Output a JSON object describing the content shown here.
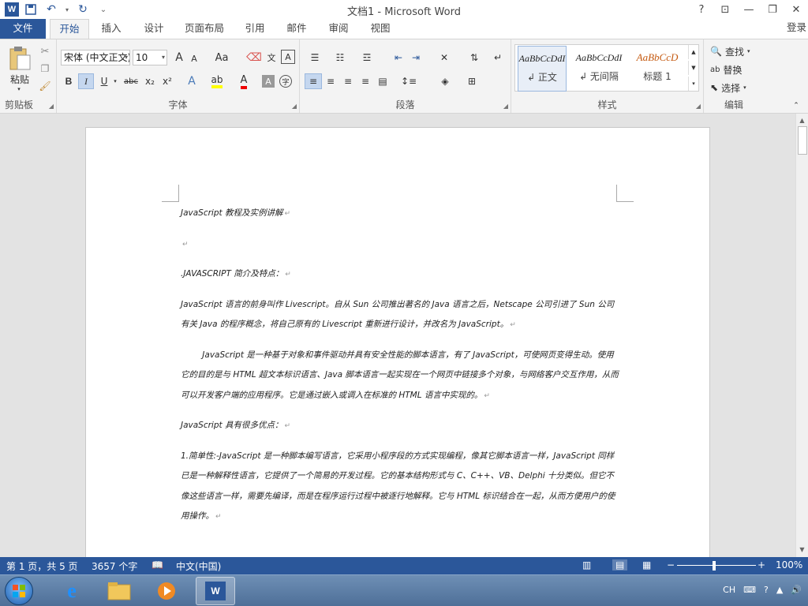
{
  "window": {
    "title": "文档1 - Microsoft Word",
    "help": "?",
    "ribbon_display": "⊡",
    "minimize": "—",
    "maximize": "❐",
    "close": "✕"
  },
  "tabs": [
    "文件",
    "开始",
    "插入",
    "设计",
    "页面布局",
    "引用",
    "邮件",
    "审阅",
    "视图"
  ],
  "signin": "登录",
  "ribbon": {
    "clipboard": {
      "label": "剪贴板",
      "paste": "粘贴"
    },
    "font": {
      "label": "字体",
      "font_name": "宋体 (中文正文)",
      "font_size": "10",
      "grow": "A",
      "shrink": "A",
      "case": "Aa",
      "bold": "B",
      "italic": "I",
      "underline": "U",
      "strike": "abc",
      "subscript": "x₂",
      "superscript": "x²"
    },
    "paragraph": {
      "label": "段落"
    },
    "styles": {
      "label": "样式",
      "items": [
        {
          "preview": "AaBbCcDdI",
          "name": "↲ 正文"
        },
        {
          "preview": "AaBbCcDdI",
          "name": "↲ 无间隔"
        },
        {
          "preview": "AaBbCcD",
          "name": "标题 1"
        }
      ],
      "heading_color": "#c55a11"
    },
    "editing": {
      "label": "编辑",
      "find": "查找",
      "replace": "替换",
      "select": "选择"
    }
  },
  "document": {
    "paragraphs": [
      {
        "text": "JavaScript 教程及实例讲解"
      },
      {
        "text": ""
      },
      {
        "text": ".JAVASCRIPT 简介及特点："
      },
      {
        "text": "JavaScript 语言的前身叫作 Livescript。自从 Sun 公司推出著名的 Java 语言之后，Netscape 公司引进了 Sun 公司有关 Java 的程序概念，将自己原有的 Livescript 重新进行设计，并改名为 JavaScript。"
      },
      {
        "text": "JavaScript 是一种基于对象和事件驱动并具有安全性能的脚本语言，有了 JavaScript，可使网页变得生动。使用它的目的是与 HTML 超文本标识语言、Java 脚本语言一起实现在一个网页中链接多个对象，与网络客户交互作用，从而可以开发客户端的应用程序。它是通过嵌入或调入在标准的 HTML 语言中实现的。"
      },
      {
        "text": "JavaScript 具有很多优点："
      },
      {
        "text": "1.简单性:-JavaScript 是一种脚本编写语言，它采用小程序段的方式实现编程，像其它脚本语言一样，JavaScript 同样已是一种解释性语言，它提供了一个简易的开发过程。它的基本结构形式与 C、C++、VB、Delphi 十分类似。但它不像这些语言一样，需要先编译，而是在程序运行过程中被逐行地解释。它与 HTML 标识结合在一起，从而方便用户的使用操作。"
      }
    ],
    "para_mark": "↵"
  },
  "status": {
    "page": "第 1 页，共 5 页",
    "words": "3657 个字",
    "language": "中文(中国)",
    "zoom": "100%"
  },
  "taskbar": {
    "lang": "CH"
  },
  "colors": {
    "accent": "#2b579a"
  }
}
